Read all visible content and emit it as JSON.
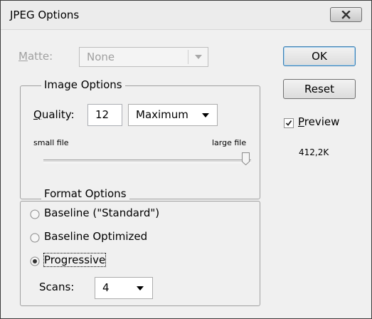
{
  "window": {
    "title": "JPEG Options",
    "close_icon": "close-icon"
  },
  "matte": {
    "label_prefix": "",
    "label_mnemonic": "M",
    "label_rest": "atte:",
    "value": "None",
    "enabled": false
  },
  "image_options": {
    "legend": "Image Options",
    "quality_label_mnemonic": "Q",
    "quality_label_rest": "uality:",
    "quality_value": "12",
    "quality_preset": "Maximum",
    "slider_min_label": "small file",
    "slider_max_label": "large file",
    "slider_level": 1.0
  },
  "format_options": {
    "legend": "Format Options",
    "options": [
      {
        "label": "Baseline (\"Standard\")",
        "selected": false
      },
      {
        "label": "Baseline Optimized",
        "selected": false
      },
      {
        "label": "Progressive",
        "selected": true
      }
    ],
    "scans_label": "Scans:",
    "scans_value": "4"
  },
  "buttons": {
    "ok": "OK",
    "reset": "Reset"
  },
  "preview": {
    "checked": true,
    "label_mnemonic": "P",
    "label_rest": "review",
    "file_size": "412,2K"
  }
}
